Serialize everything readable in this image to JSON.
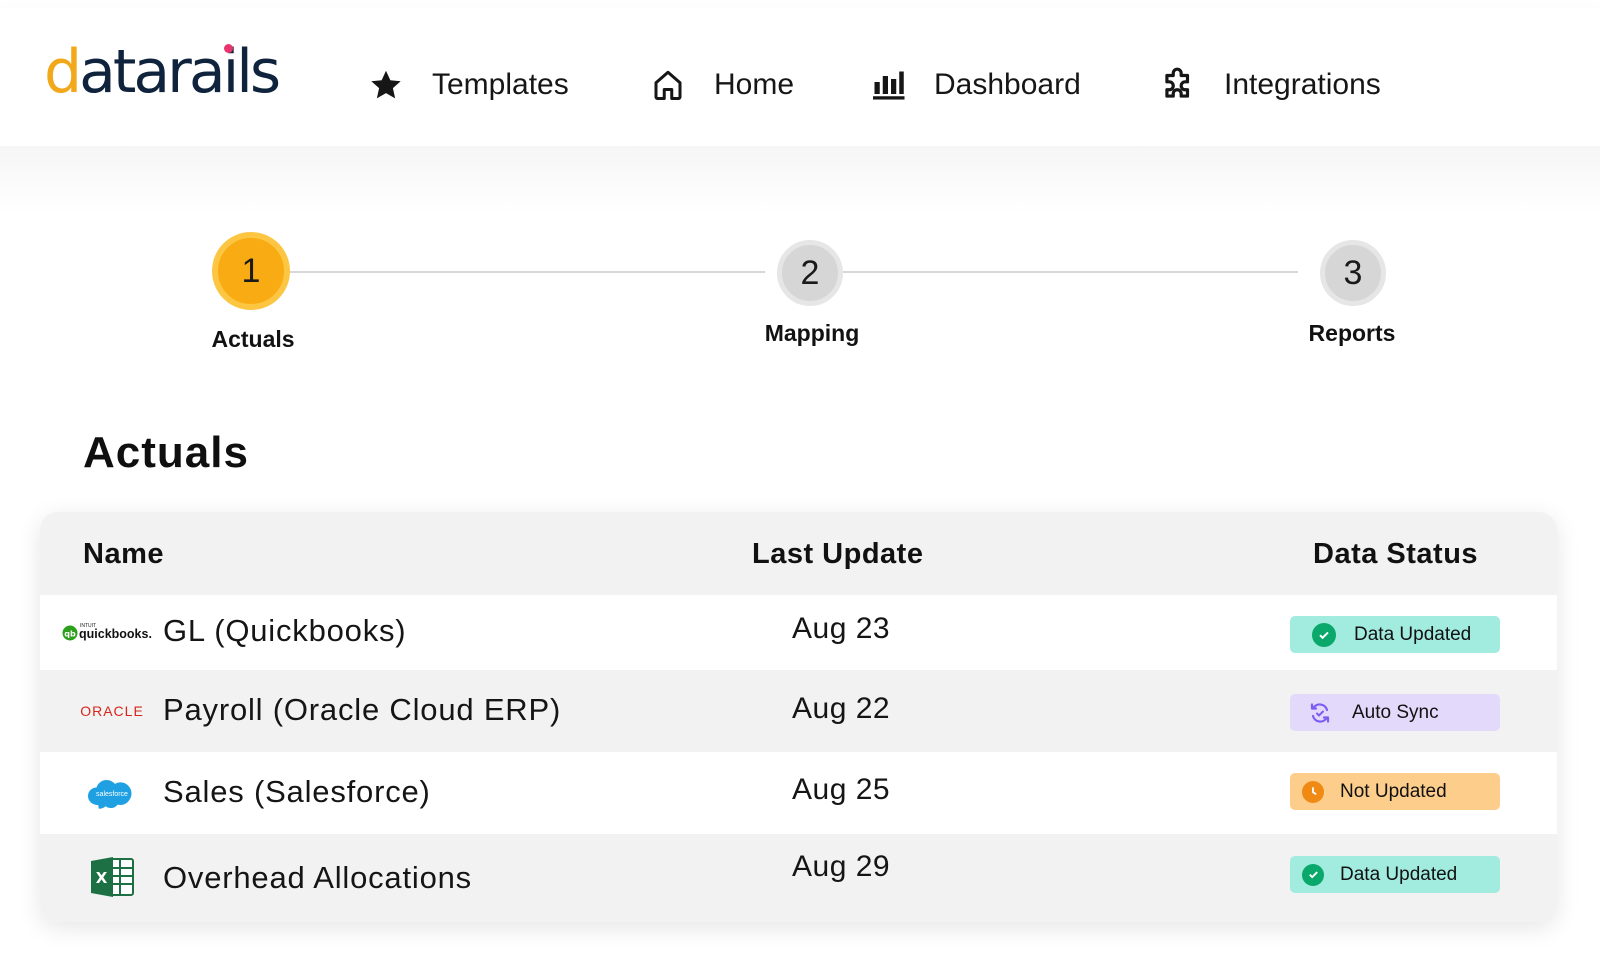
{
  "brand": {
    "logo_text": "datarails"
  },
  "nav": [
    {
      "label": "Templates",
      "icon": "star-icon"
    },
    {
      "label": "Home",
      "icon": "home-icon"
    },
    {
      "label": "Dashboard",
      "icon": "bar-chart-icon"
    },
    {
      "label": "Integrations",
      "icon": "puzzle-icon"
    }
  ],
  "stepper": {
    "steps": [
      {
        "number": "1",
        "label": "Actuals",
        "active": true
      },
      {
        "number": "2",
        "label": "Mapping",
        "active": false
      },
      {
        "number": "3",
        "label": "Reports",
        "active": false
      }
    ]
  },
  "section": {
    "title": "Actuals"
  },
  "table": {
    "headers": {
      "name": "Name",
      "last_update": "Last Update",
      "data_status": "Data Status"
    },
    "rows": [
      {
        "source_logo": "quickbooks-logo",
        "logo_text": "quickbooks.",
        "logo_small": "INTUIT",
        "name": "GL (Quickbooks)",
        "last_update": "Aug 23",
        "status": "Data Updated",
        "status_icon": "check-circle-icon",
        "status_bg": "#a2ebdf",
        "status_icon_color": "#0aa86a"
      },
      {
        "source_logo": "oracle-logo",
        "logo_text": "ORACLE",
        "name": "Payroll (Oracle Cloud ERP)",
        "last_update": "Aug 22",
        "status": "Auto Sync",
        "status_icon": "sync-icon",
        "status_bg": "#e3dafb",
        "status_icon_color": "#7c5cf2"
      },
      {
        "source_logo": "salesforce-logo",
        "logo_text": "salesforce",
        "name": "Sales (Salesforce)",
        "last_update": "Aug 25",
        "status": "Not Updated",
        "status_icon": "clock-icon",
        "status_bg": "#fdcd8b",
        "status_icon_color": "#f08a14"
      },
      {
        "source_logo": "excel-logo",
        "logo_text": "X",
        "name": "Overhead Allocations",
        "last_update": "Aug 29",
        "status": "Data Updated",
        "status_icon": "check-circle-icon",
        "status_bg": "#a2ebdf",
        "status_icon_color": "#0aa86a"
      }
    ]
  },
  "colors": {
    "accent": "#f8ab13",
    "accent_ring": "#fcc542",
    "logo_dark": "#10233d",
    "logo_pink_dot": "#e8356d",
    "oracle_red": "#d6271d",
    "salesforce_blue": "#1fa0e3",
    "excel_green": "#1d7044",
    "quickbooks_green": "#2ca01c"
  }
}
